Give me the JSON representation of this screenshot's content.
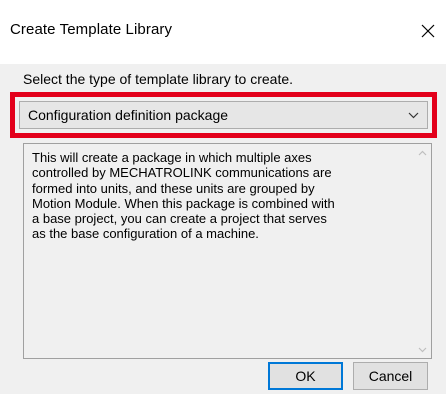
{
  "window": {
    "title": "Create Template Library"
  },
  "prompt": {
    "label": "Select the type of template library to create."
  },
  "library_type": {
    "selected": "Configuration definition package"
  },
  "description": {
    "text": "This will create a package in which multiple axes\ncontrolled by MECHATROLINK communications are\nformed into units, and these units are grouped by\nMotion Module. When this package is combined with\na base project, you can create a project that serves\nas the base configuration of a machine."
  },
  "buttons": {
    "ok_label": "OK",
    "cancel_label": "Cancel"
  },
  "colors": {
    "highlight": "#e3001b",
    "default_button_border": "#0078d7",
    "dialog_body": "#f0f0f0"
  },
  "icons": {
    "close": "close-icon",
    "dropdown": "chevron-down-icon",
    "scroll_up": "scroll-up-arrow-icon",
    "scroll_down": "scroll-down-arrow-icon"
  }
}
